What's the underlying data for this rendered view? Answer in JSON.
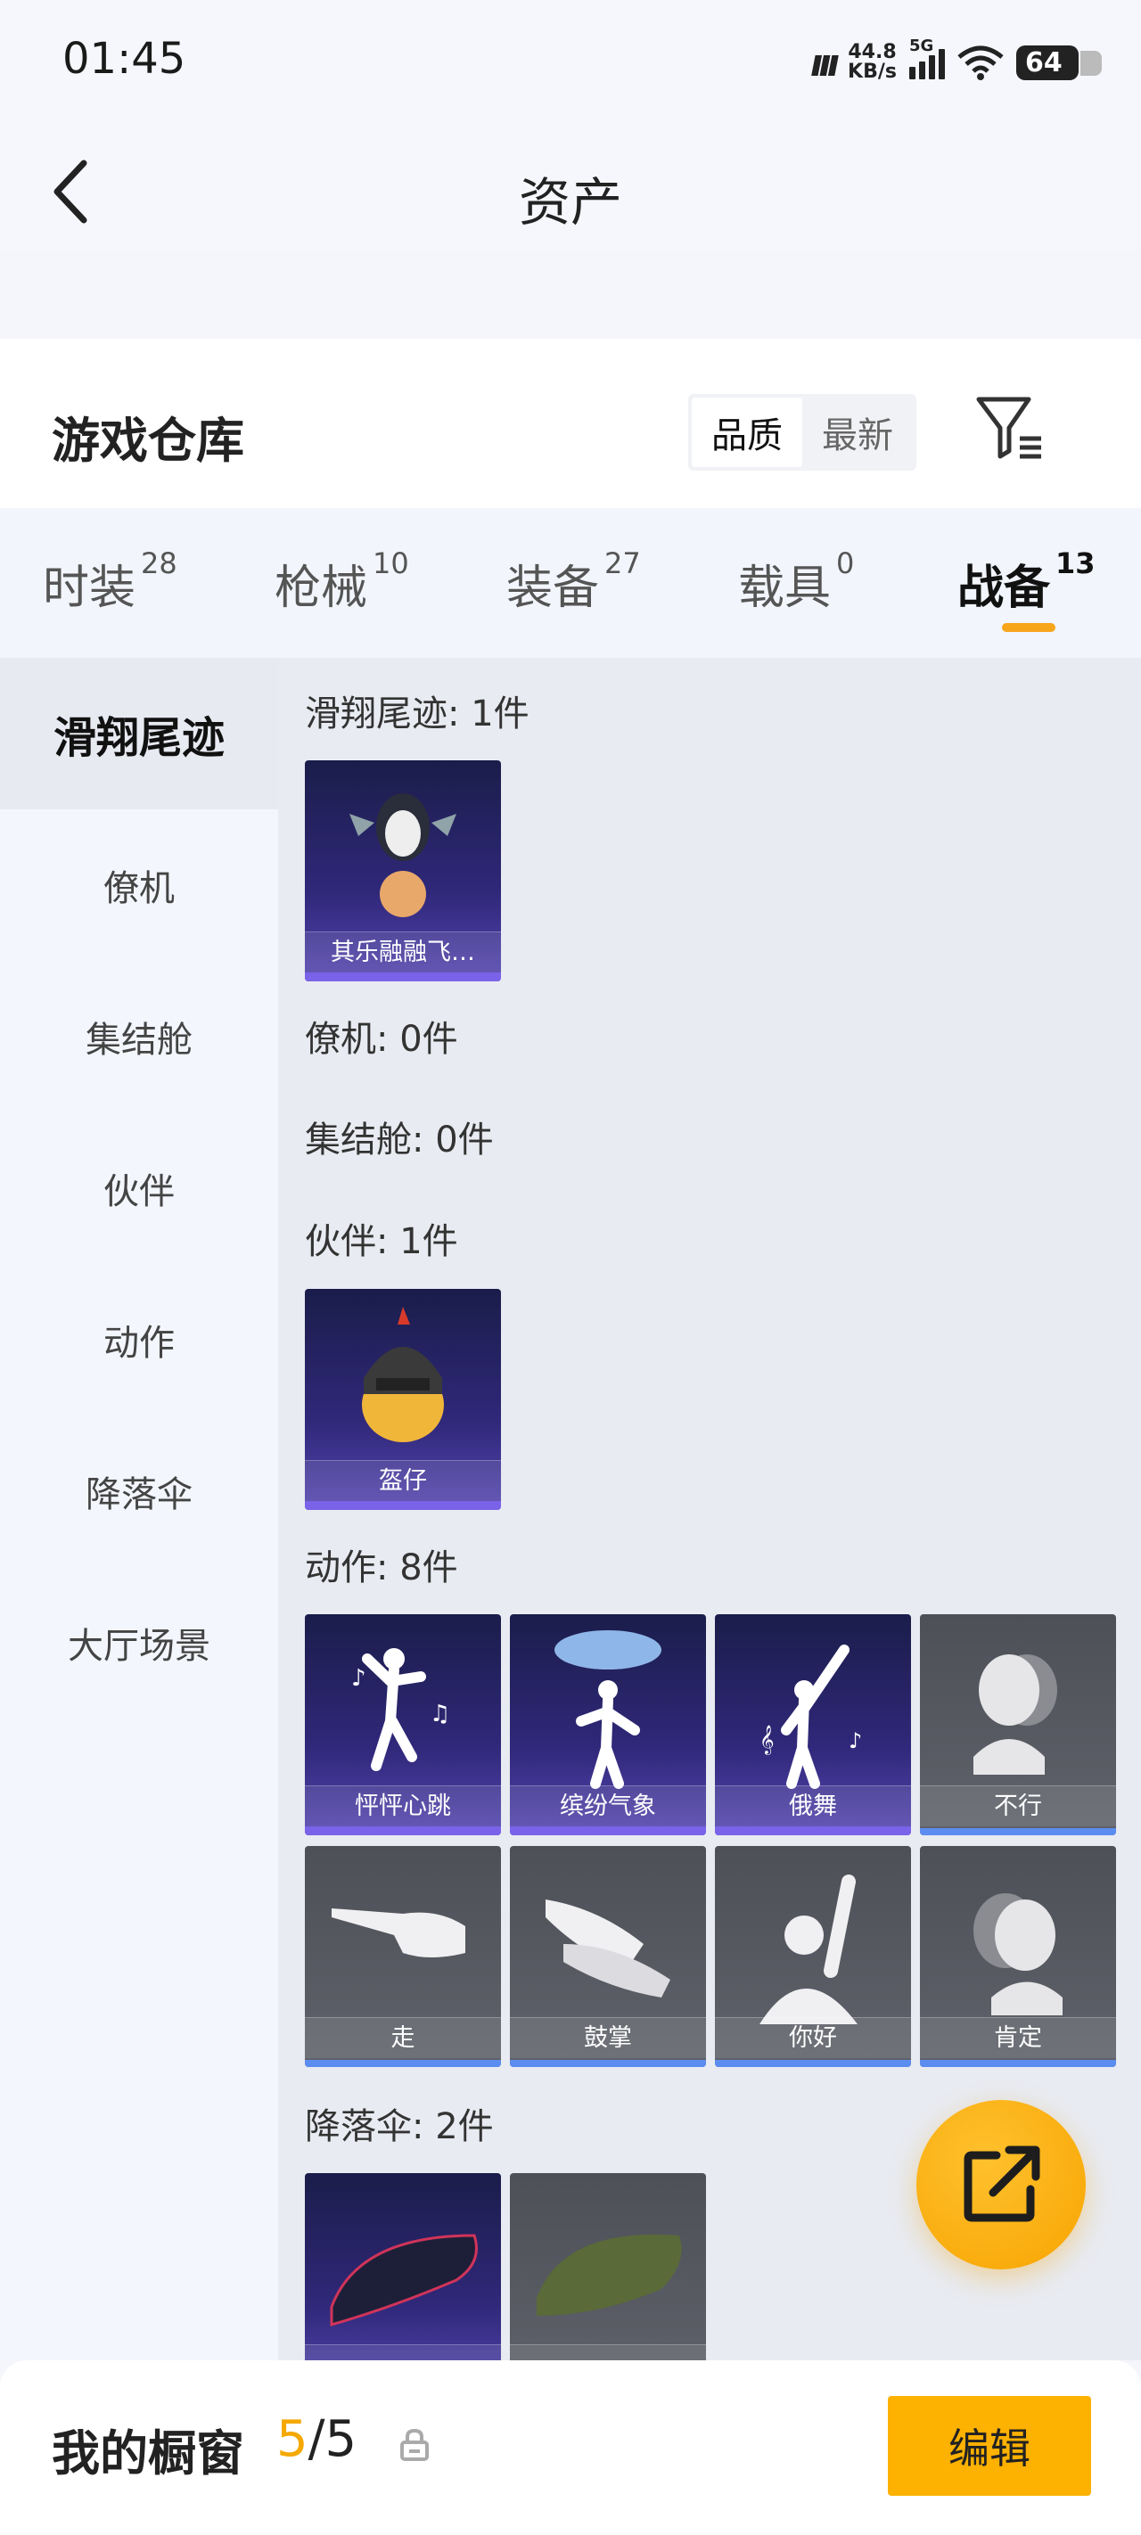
{
  "status_bar": {
    "time": "01:45",
    "speed": "44.8",
    "speed_unit": "KB/s",
    "network": "5G",
    "battery": "64"
  },
  "header": {
    "title": "资产"
  },
  "warehouse": {
    "title": "游戏仓库",
    "sort_options": [
      "品质",
      "最新"
    ],
    "sort_selected": "品质"
  },
  "tabs": [
    {
      "label": "时装",
      "count": "28"
    },
    {
      "label": "枪械",
      "count": "10"
    },
    {
      "label": "装备",
      "count": "27"
    },
    {
      "label": "载具",
      "count": "0"
    },
    {
      "label": "战备",
      "count": "13",
      "active": true
    }
  ],
  "sidebar": {
    "items": [
      "滑翔尾迹",
      "僚机",
      "集结舱",
      "伙伴",
      "动作",
      "降落伞",
      "大厅场景"
    ],
    "active": "滑翔尾迹"
  },
  "sections": [
    {
      "title": "滑翔尾迹: 1件",
      "items": [
        {
          "label": "其乐融融飞…",
          "style": "purple"
        }
      ]
    },
    {
      "title": "僚机: 0件",
      "items": []
    },
    {
      "title": "集结舱: 0件",
      "items": []
    },
    {
      "title": "伙伴: 1件",
      "items": [
        {
          "label": "盔仔",
          "style": "purple"
        }
      ]
    },
    {
      "title": "动作: 8件",
      "items": [
        {
          "label": "怦怦心跳",
          "style": "purple"
        },
        {
          "label": "缤纷气象",
          "style": "purple"
        },
        {
          "label": "俄舞",
          "style": "purple"
        },
        {
          "label": "不行",
          "style": "gray"
        },
        {
          "label": "走",
          "style": "gray"
        },
        {
          "label": "鼓掌",
          "style": "gray"
        },
        {
          "label": "你好",
          "style": "gray"
        },
        {
          "label": "肯定",
          "style": "gray"
        }
      ]
    },
    {
      "title": "降落伞: 2件",
      "items": [
        {
          "label": "",
          "style": "purple"
        },
        {
          "label": "",
          "style": "gray"
        }
      ]
    }
  ],
  "bottom_bar": {
    "title": "我的橱窗",
    "current": "5",
    "separator": "/",
    "total": "5",
    "edit_label": "编辑"
  },
  "colors": {
    "accent": "#fdb100",
    "tab_underline": "#f7a51b",
    "card_purple": "#30287a",
    "card_gray": "#5f626a"
  }
}
